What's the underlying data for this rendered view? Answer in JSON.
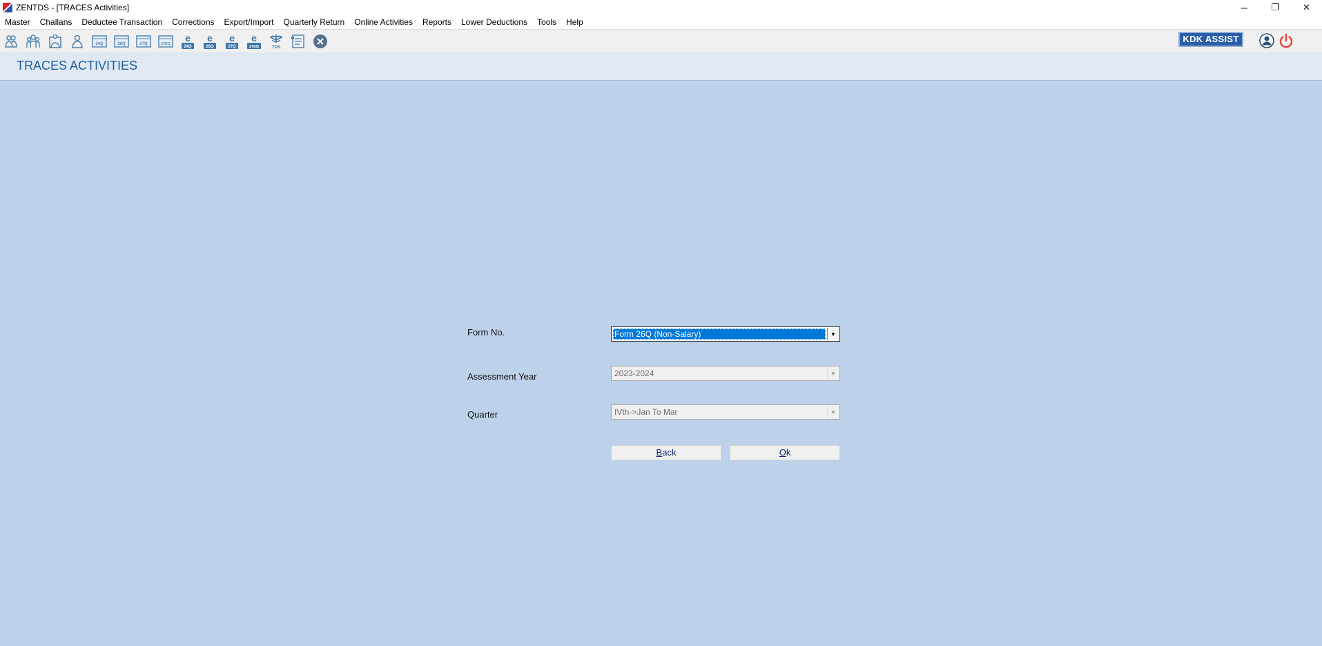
{
  "window": {
    "title": "ZENTDS - [TRACES Activities]",
    "controls": {
      "minimize": "─",
      "restore": "❐",
      "close": "✕"
    }
  },
  "menu": [
    "Master",
    "Challans",
    "Deductee Transaction",
    "Corrections",
    "Export/Import",
    "Quarterly Return",
    "Online Activities",
    "Reports",
    "Lower Deductions",
    "Tools",
    "Help"
  ],
  "toolbar": {
    "icons": [
      {
        "name": "deductor-icon",
        "caption": ""
      },
      {
        "name": "deductee-group-icon",
        "caption": ""
      },
      {
        "name": "employee-icon",
        "caption": ""
      },
      {
        "name": "person-icon",
        "caption": ""
      },
      {
        "name": "form-24q-icon",
        "caption": "24Q"
      },
      {
        "name": "form-26q-icon",
        "caption": "26Q"
      },
      {
        "name": "form-27q-icon",
        "caption": "27Q"
      },
      {
        "name": "form-27eq-icon",
        "caption": "27EQ"
      },
      {
        "name": "e-24q-icon",
        "caption": "24Q"
      },
      {
        "name": "e-26q-icon",
        "caption": "26Q"
      },
      {
        "name": "e-27q-icon",
        "caption": "27Q"
      },
      {
        "name": "e-27eq-icon",
        "caption": "27EQ"
      },
      {
        "name": "tds-icon",
        "caption": "TDS"
      },
      {
        "name": "report-icon",
        "caption": ""
      },
      {
        "name": "close-circle-icon",
        "caption": ""
      }
    ],
    "kdk_assist": "KDK ASSIST"
  },
  "page": {
    "title": "TRACES ACTIVITIES"
  },
  "form": {
    "form_no_label": "Form No.",
    "form_no_value": "Form 26Q (Non-Salary)",
    "ay_label": "Assessment Year",
    "ay_value": "2023-2024",
    "quarter_label": "Quarter",
    "quarter_value": "IVth->Jan To Mar",
    "back_first": "B",
    "back_rest": "ack",
    "ok_first": "O",
    "ok_rest": "k"
  }
}
